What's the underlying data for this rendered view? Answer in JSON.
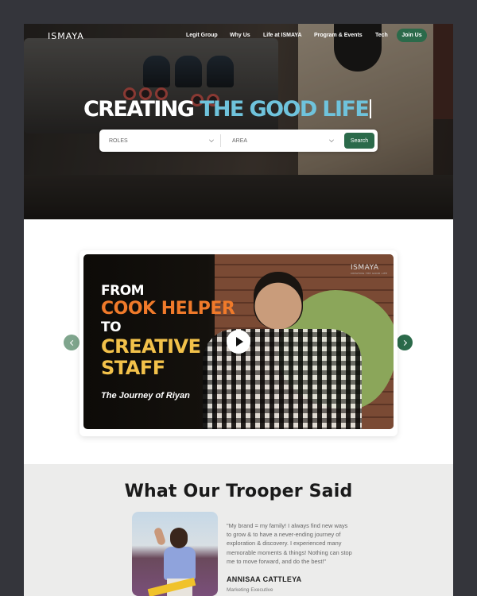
{
  "nav": {
    "logo": "ISMAYA",
    "links": [
      "Legit Group",
      "Why Us",
      "Life at ISMAYA",
      "Program & Events",
      "Tech"
    ],
    "join_label": "Join Us"
  },
  "hero": {
    "headline_white": "CREATING",
    "headline_teal": "THE GOOD LIFE",
    "search": {
      "roles_value": "ROLES",
      "area_value": "AREA",
      "button_label": "Search"
    }
  },
  "slider": {
    "brand": "ISMAYA",
    "brand_tagline": "CREATING THE GOOD LIFE",
    "line1": "FROM",
    "line2": "COOK HELPER",
    "line3": "TO",
    "line4": "CREATIVE",
    "line5": "STAFF",
    "caption": "The Journey of Riyan"
  },
  "testimonial": {
    "title": "What Our Trooper Said",
    "quote": "\"My brand = my family! I always find new ways to grow & to have a never-ending journey of exploration & discovery. I experienced many memorable moments & things! Nothing can stop me to move forward, and do the best!\"",
    "name": "ANNISAA CATTLEYA",
    "role": "Marketing Executive"
  },
  "colors": {
    "brand_green": "#2b6a4a",
    "headline_teal": "#6fc3dc",
    "slide_orange": "#f07a2a",
    "slide_yellow": "#f2c14a",
    "backdrop": "#34353b"
  },
  "icons": {
    "select_chevron": "chevron-down-icon",
    "prev": "chevron-left-icon",
    "next": "chevron-right-icon",
    "play": "play-icon"
  }
}
